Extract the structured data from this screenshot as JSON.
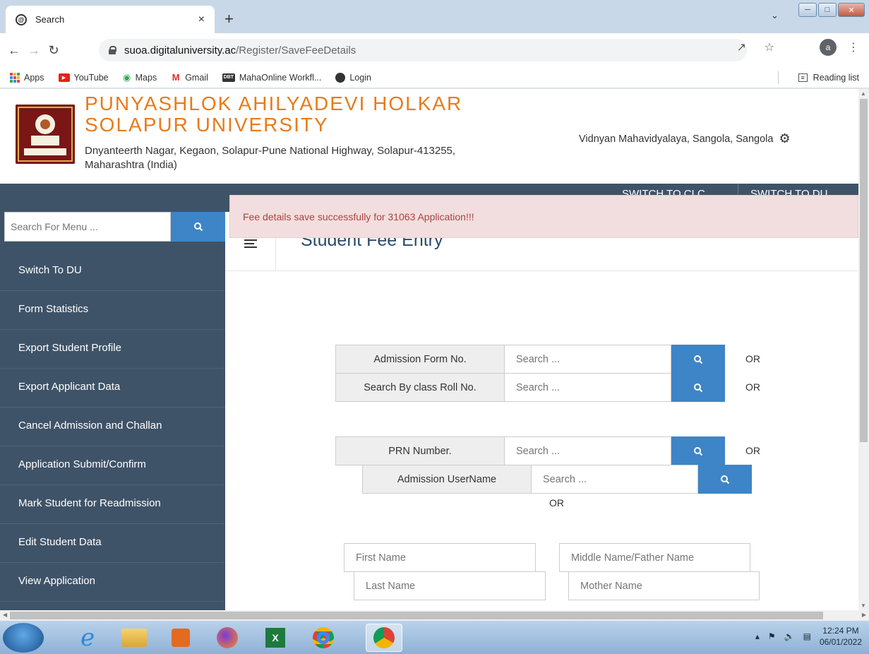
{
  "browser": {
    "tab_title": "Search",
    "tab_close": "×",
    "new_tab": "+",
    "url_host": "suoa.digitaluniversity.ac",
    "url_path": "/Register/SaveFeeDetails",
    "profile_initial": "a",
    "bookmarks": [
      {
        "label": "Apps"
      },
      {
        "label": "YouTube"
      },
      {
        "label": "Maps"
      },
      {
        "label": "Gmail"
      },
      {
        "label": "MahaOnline Workfl..."
      },
      {
        "label": "Login"
      }
    ],
    "reading_list": "Reading list"
  },
  "header": {
    "uni_line1": "PUNYASHLOK AHILYADEVI HOLKAR",
    "uni_line2": "SOLAPUR UNIVERSITY",
    "address": "Dnyanteerth Nagar, Kegaon, Solapur-Pune National Highway, Solapur-413255, Maharashtra (India)",
    "college": "Vidnyan Mahavidyalaya, Sangola, Sangola"
  },
  "navbar": {
    "switch_clc": "SWITCH TO CLC",
    "switch_du": "SWITCH TO DU"
  },
  "sidebar": {
    "search_placeholder": "Search For Menu ...",
    "items": [
      {
        "label": "Switch To DU"
      },
      {
        "label": "Form Statistics"
      },
      {
        "label": "Export Student Profile"
      },
      {
        "label": "Export Applicant Data"
      },
      {
        "label": "Cancel Admission and Challan"
      },
      {
        "label": "Application Submit/Confirm"
      },
      {
        "label": "Mark Student for Readmission"
      },
      {
        "label": "Edit Student Data"
      },
      {
        "label": "View Application"
      }
    ]
  },
  "main": {
    "title": "Student Fee Entry",
    "alert": "Fee details save successfully for 31063 Application!!!",
    "search_placeholder": "Search ...",
    "or": "OR",
    "search_rows": [
      {
        "label": "Admission Form No."
      },
      {
        "label": "Search By class Roll No."
      },
      {
        "label": "PRN Number."
      },
      {
        "label": "Admission UserName"
      }
    ],
    "name_fields": {
      "first": "First Name",
      "middle": "Middle Name/Father Name",
      "last": "Last Name",
      "mother": "Mother Name"
    }
  },
  "taskbar": {
    "time": "12:24 PM",
    "date": "06/01/2022"
  },
  "colors": {
    "brand_orange": "#e87b1a",
    "nav_dark": "#3f5368",
    "button_blue": "#3d85c6",
    "alert_bg": "#f2dede",
    "alert_text": "#a94442"
  }
}
